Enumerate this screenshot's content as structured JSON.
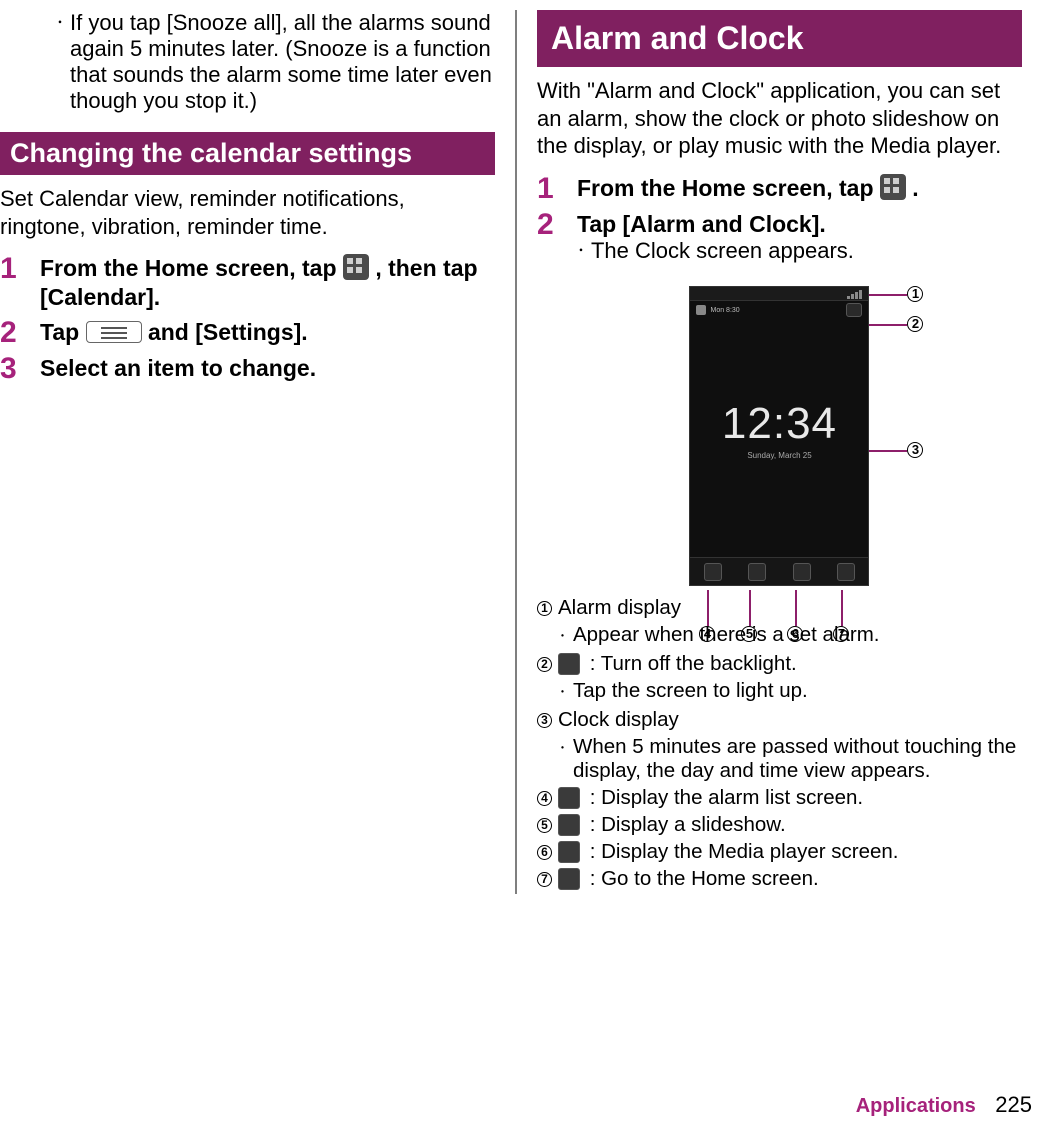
{
  "left": {
    "snooze_bullet": "If you tap [Snooze all], all the alarms sound again 5 minutes later. (Snooze is a function that sounds the alarm some time later even though you stop it.)",
    "section_heading": "Changing the calendar settings",
    "section_intro": "Set Calendar view, reminder notifications, ringtone, vibration, reminder time.",
    "steps": {
      "s1": {
        "num": "1",
        "text_before_icon": "From the Home screen, tap ",
        "text_after_icon": " , then tap [Calendar]."
      },
      "s2": {
        "num": "2",
        "text_before": "Tap ",
        "text_after": " and [Settings]."
      },
      "s3": {
        "num": "3",
        "text": "Select an item to change."
      }
    }
  },
  "right": {
    "section_heading": "Alarm and Clock",
    "intro": "With \"Alarm and Clock\" application, you can set an alarm, show the clock or photo slideshow on the display, or play music with the Media player.",
    "steps": {
      "s1": {
        "num": "1",
        "text_before": "From the Home screen, tap ",
        "text_after": " ."
      },
      "s2": {
        "num": "2",
        "text": "Tap [Alarm and Clock].",
        "sub": "The Clock screen appears."
      }
    },
    "figure": {
      "clock_time": "12:34",
      "clock_day": "Sunday, March 25",
      "datebar_text": "Mon 8:30",
      "labels": {
        "c1": "1",
        "c2": "2",
        "c3": "3",
        "c4": "4",
        "c5": "5",
        "c6": "6",
        "c7": "7"
      }
    },
    "legend": {
      "items": [
        {
          "num": "1",
          "title": "Alarm display",
          "sub": "Appear when there is a set alarm."
        },
        {
          "num": "2",
          "icon": true,
          "text": ": Turn off the backlight.",
          "sub": "Tap the screen to light up."
        },
        {
          "num": "3",
          "title": "Clock display",
          "sub": "When 5 minutes are passed without touching the display, the day and time view appears."
        },
        {
          "num": "4",
          "icon": true,
          "text": ": Display the alarm list screen."
        },
        {
          "num": "5",
          "icon": true,
          "text": ": Display a slideshow."
        },
        {
          "num": "6",
          "icon": true,
          "text": ": Display the Media player screen."
        },
        {
          "num": "7",
          "icon": true,
          "text": ": Go to the Home screen."
        }
      ]
    }
  },
  "footer": {
    "section": "Applications",
    "page": "225"
  }
}
